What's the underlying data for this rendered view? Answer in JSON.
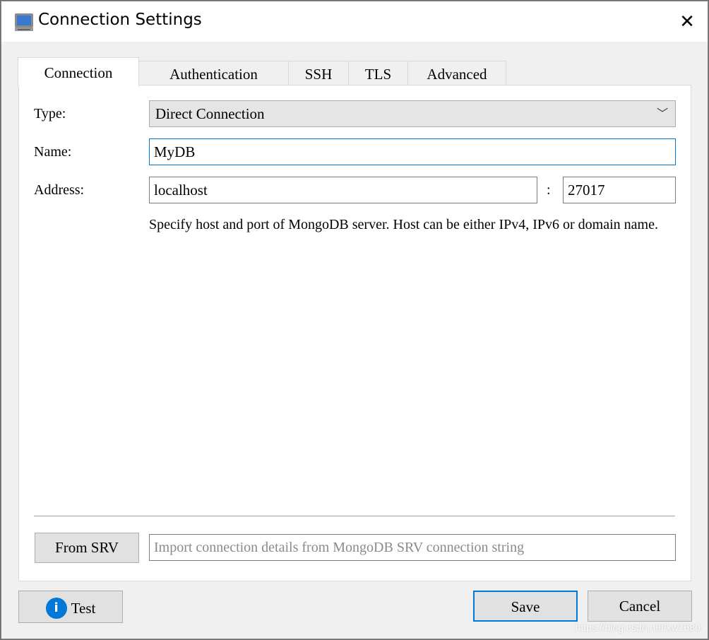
{
  "window": {
    "title": "Connection Settings",
    "icon": "computer-icon",
    "close_icon": "close-icon"
  },
  "tabs": [
    {
      "label": "Connection",
      "active": true
    },
    {
      "label": "Authentication"
    },
    {
      "label": "SSH"
    },
    {
      "label": "TLS"
    },
    {
      "label": "Advanced"
    }
  ],
  "form": {
    "type_label": "Type:",
    "type_value": "Direct Connection",
    "name_label": "Name:",
    "name_value": "MyDB",
    "address_label": "Address:",
    "host_value": "localhost",
    "colon": ":",
    "port_value": "27017",
    "hint": "Specify host and port of MongoDB server. Host can be either IPv4, IPv6 or domain name."
  },
  "srv": {
    "button": "From SRV",
    "placeholder": "Import connection details from MongoDB SRV connection string"
  },
  "footer": {
    "test": "Test",
    "save": "Save",
    "cancel": "Cancel"
  },
  "accent": "#0078d7",
  "watermark": "https://blog.csdn.net/xw1680"
}
